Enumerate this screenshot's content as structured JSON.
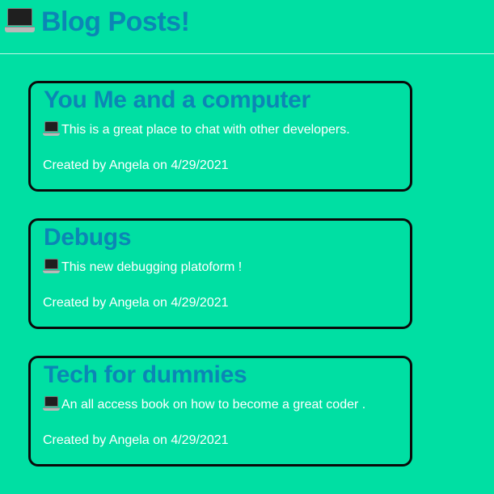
{
  "header": {
    "title": "Blog Posts!",
    "icon": "laptop-icon"
  },
  "posts": [
    {
      "title": "You Me and a computer",
      "body": "This is a great place to chat with other developers.",
      "meta": "Created by Angela on 4/29/2021"
    },
    {
      "title": "Debugs",
      "body": "This new debugging platoform !",
      "meta": "Created by Angela on 4/29/2021"
    },
    {
      "title": "Tech for dummies",
      "body": "An all access book on how to become a great coder .",
      "meta": "Created by Angela on 4/29/2021"
    }
  ],
  "colors": {
    "background": "#00dfa3",
    "title": "#0b86b5",
    "text": "#ffffff",
    "card_border": "#0a0a0a"
  }
}
